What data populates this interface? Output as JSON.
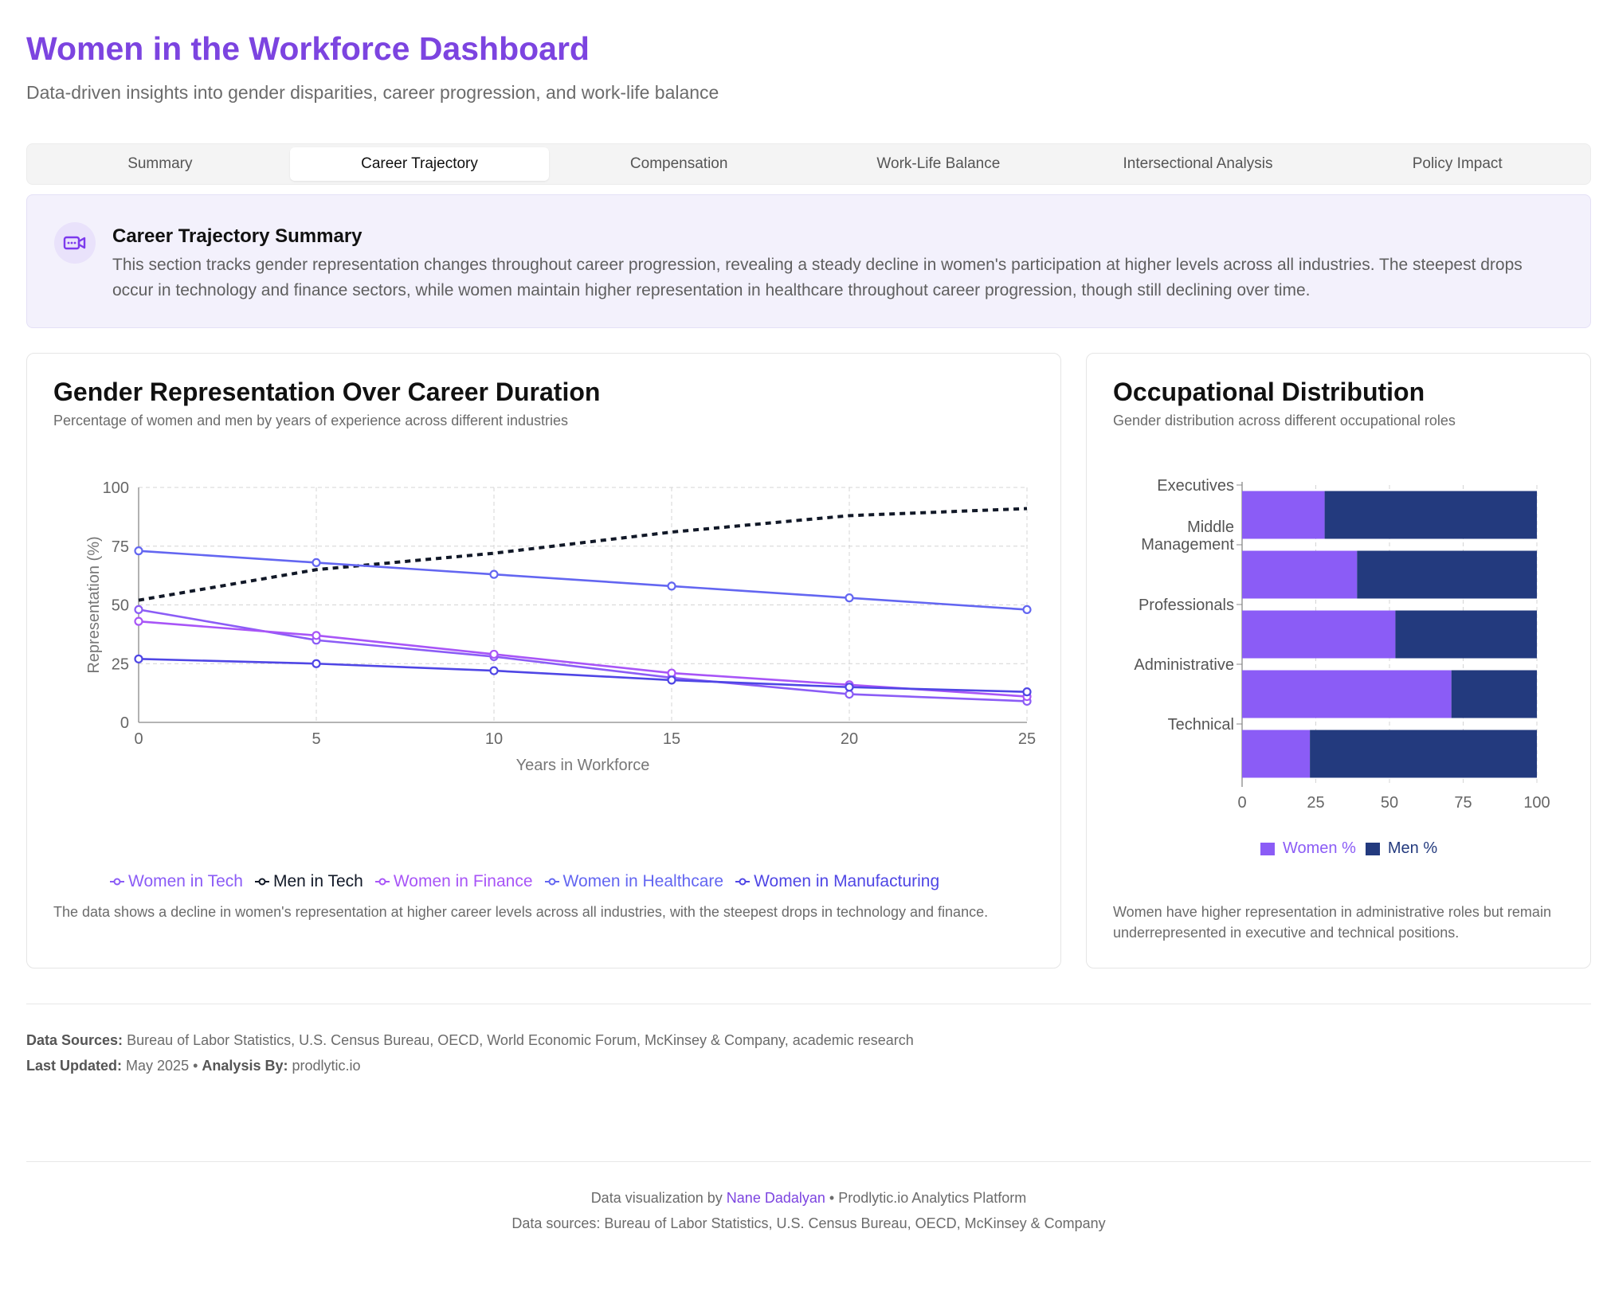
{
  "header": {
    "title": "Women in the Workforce Dashboard",
    "subtitle": "Data-driven insights into gender disparities, career progression, and work-life balance"
  },
  "tabs": [
    {
      "label": "Summary",
      "active": false
    },
    {
      "label": "Career Trajectory",
      "active": true
    },
    {
      "label": "Compensation",
      "active": false
    },
    {
      "label": "Work-Life Balance",
      "active": false
    },
    {
      "label": "Intersectional Analysis",
      "active": false
    },
    {
      "label": "Policy Impact",
      "active": false
    }
  ],
  "summary": {
    "icon": "video-camera-icon",
    "title": "Career Trajectory Summary",
    "text": "This section tracks gender representation changes throughout career progression, revealing a steady decline in women's participation at higher levels across all industries. The steepest drops occur in technology and finance sectors, while women maintain higher representation in healthcare throughout career progression, though still declining over time."
  },
  "line_card": {
    "title": "Gender Representation Over Career Duration",
    "subtitle": "Percentage of women and men by years of experience across different industries",
    "note": "The data shows a decline in women's representation at higher career levels across all industries, with the steepest drops in technology and finance."
  },
  "bar_card": {
    "title": "Occupational Distribution",
    "subtitle": "Gender distribution across different occupational roles",
    "note": "Women have higher representation in administrative roles but remain underrepresented in executive and technical positions."
  },
  "chart_data": [
    {
      "type": "line",
      "xlabel": "Years in Workforce",
      "ylabel": "Representation (%)",
      "x": [
        0,
        5,
        10,
        15,
        20,
        25
      ],
      "xlim": [
        0,
        25
      ],
      "ylim": [
        0,
        100
      ],
      "yticks": [
        0,
        25,
        50,
        75,
        100
      ],
      "grid": true,
      "legend": "bottom",
      "series": [
        {
          "name": "Women in Tech",
          "values": [
            48,
            35,
            28,
            19,
            12,
            9
          ],
          "color": "#8b5cf6",
          "dashed": false
        },
        {
          "name": "Men in Tech",
          "values": [
            52,
            65,
            72,
            81,
            88,
            91
          ],
          "color": "#111827",
          "dashed": true
        },
        {
          "name": "Women in Finance",
          "values": [
            43,
            37,
            29,
            21,
            16,
            11
          ],
          "color": "#a855f7",
          "dashed": false
        },
        {
          "name": "Women in Healthcare",
          "values": [
            73,
            68,
            63,
            58,
            53,
            48
          ],
          "color": "#6366f1",
          "dashed": false
        },
        {
          "name": "Women in Manufacturing",
          "values": [
            27,
            25,
            22,
            18,
            15,
            13
          ],
          "color": "#4f46e5",
          "dashed": false
        }
      ]
    },
    {
      "type": "bar",
      "orientation": "horizontal",
      "stacked": true,
      "categories": [
        "Executives",
        "Middle Management",
        "Professionals",
        "Administrative",
        "Technical"
      ],
      "xlim": [
        0,
        100
      ],
      "xticks": [
        0,
        25,
        50,
        75,
        100
      ],
      "legend": "bottom",
      "series": [
        {
          "name": "Women %",
          "values": [
            28,
            39,
            52,
            71,
            23
          ],
          "color": "#8b5cf6"
        },
        {
          "name": "Men %",
          "values": [
            72,
            61,
            48,
            29,
            77
          ],
          "color": "#233a7e"
        }
      ]
    }
  ],
  "sources": {
    "label": "Data Sources:",
    "text": "Bureau of Labor Statistics, U.S. Census Bureau, OECD, World Economic Forum, McKinsey & Company, academic research",
    "updated_label": "Last Updated:",
    "updated": "May 2025",
    "analysis_label": "Analysis By:",
    "analysis": "prodlytic.io"
  },
  "footer": {
    "prefix": "Data visualization by",
    "author": "Nane Dadalyan",
    "platform": "• Prodlytic.io Analytics Platform",
    "sources": "Data sources: Bureau of Labor Statistics, U.S. Census Bureau, OECD, McKinsey & Company"
  }
}
